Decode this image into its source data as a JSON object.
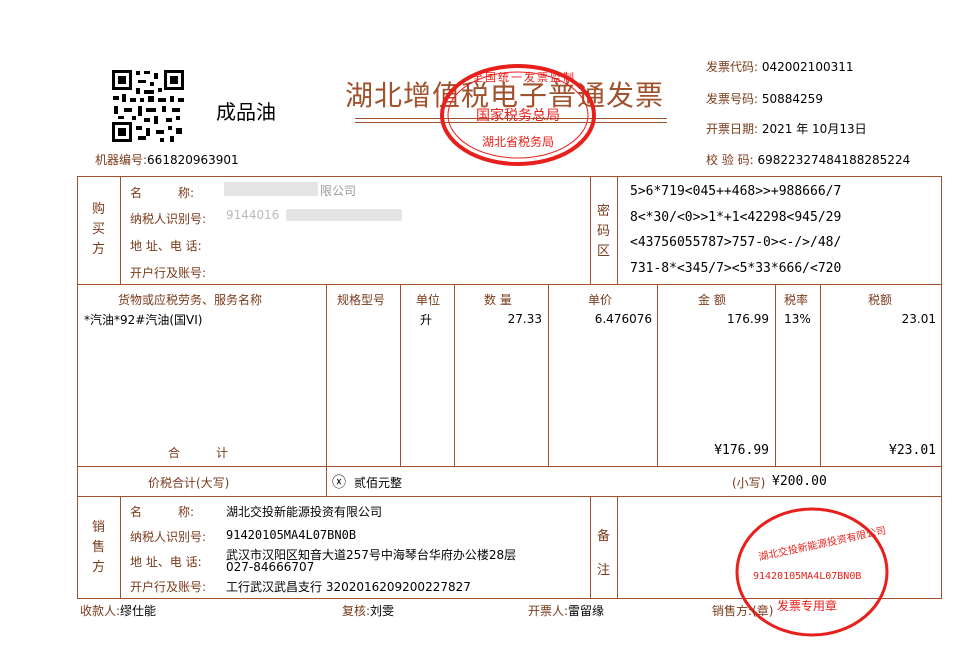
{
  "header": {
    "product_type": "成品油",
    "title": "湖北增值税电子普通发票",
    "machine_no_label": "机器编号:",
    "machine_no": "661820963901",
    "invoice_code_label": "发票代码:",
    "invoice_code": "042002100311",
    "invoice_no_label": "发票号码:",
    "invoice_no": "50884259",
    "issue_date_label": "开票日期:",
    "issue_date": "2021 年 10月13日",
    "check_code_label": "校 验 码:",
    "check_code": "69822327484188285224"
  },
  "tax_seal": {
    "top_text": "全国统一发票监制",
    "middle_text": "国家税务总局",
    "bottom_text": "湖北省税务局"
  },
  "buyer": {
    "section_label": "购买方",
    "name_label": "名　　　称:",
    "name_value": "限公司",
    "tax_id_label": "纳税人识别号:",
    "tax_id_value": "9144016",
    "address_label": "地 址、电 话:",
    "bank_label": "开户行及账号:"
  },
  "cipher": {
    "section_label": "密码区",
    "lines": [
      "5>6*719<045++468>>+988666/7",
      "8<*30/<0>>1*+1<42298<945/29",
      "<43756055787>757-0><-/>/48/",
      "731-8*<345/7><5*33*666/<720"
    ]
  },
  "items": {
    "headers": {
      "name": "货物或应税劳务、服务名称",
      "spec": "规格型号",
      "unit": "单位",
      "qty": "数 量",
      "price": "单价",
      "amount": "金 额",
      "rate": "税率",
      "tax": "税额"
    },
    "row": {
      "name": "*汽油*92#汽油(国VI)",
      "unit": "升",
      "qty": "27.33",
      "price": "6.476076",
      "amount": "176.99",
      "rate": "13%",
      "tax": "23.01"
    },
    "total_label": "合　　　计",
    "total_amount": "¥176.99",
    "total_tax": "¥23.01"
  },
  "grand_total": {
    "label": "价税合计(大写)",
    "circle_x": "ⓧ",
    "upper": "贰佰元整",
    "lower_label": "(小写)",
    "lower_value": "¥200.00"
  },
  "seller": {
    "section_label": "销售方",
    "name_label": "名　　　称:",
    "name_value": "湖北交投新能源投资有限公司",
    "tax_id_label": "纳税人识别号:",
    "tax_id_value": "91420105MA4L07BN0B",
    "address_label": "地 址、电 话:",
    "address_value": "武汉市汉阳区知音大道257号中海琴台华府办公楼28层",
    "phone_value": "027-84666707",
    "bank_label": "开户行及账号:",
    "bank_value": "工行武汉武昌支行 3202016209200227827",
    "remark_label": "备注"
  },
  "seller_seal": {
    "top_text": "湖北交投新能源投资有限公司",
    "tax_id": "91420105MA4L07BN0B",
    "bottom_text": "发票专用章"
  },
  "footer": {
    "payee_label": "收款人:",
    "payee": "缪仕能",
    "reviewer_label": "复核:",
    "reviewer": "刘雯",
    "drawer_label": "开票人:",
    "drawer": "雷留缘",
    "seller_label": "销售方:(章)"
  }
}
